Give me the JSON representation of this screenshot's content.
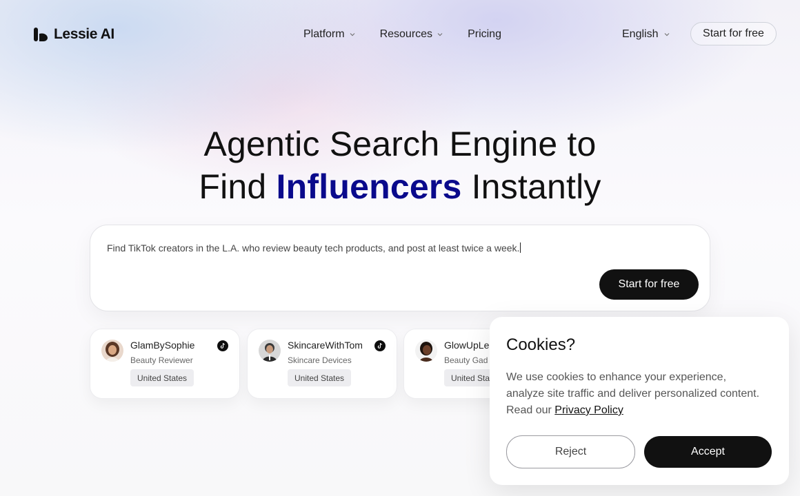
{
  "header": {
    "brand": "Lessie AI",
    "nav": [
      {
        "label": "Platform",
        "has_dropdown": true
      },
      {
        "label": "Resources",
        "has_dropdown": true
      },
      {
        "label": "Pricing",
        "has_dropdown": false
      }
    ],
    "language": "English",
    "cta": "Start for free"
  },
  "hero": {
    "line1": "Agentic Search Engine to",
    "line2_prefix": "Find ",
    "line2_accent": "Influencers",
    "line2_suffix": " Instantly",
    "accent_color": "#0a0a8c"
  },
  "search": {
    "query": "Find TikTok creators in the L.A. who review beauty tech products, and post at least twice a week.",
    "cta": "Start for free"
  },
  "creators": [
    {
      "name": "GlamBySophie",
      "role": "Beauty Reviewer",
      "location": "United States",
      "platform_icon": "tiktok-icon"
    },
    {
      "name": "SkincareWithTom",
      "role": "Skincare Devices",
      "location": "United States",
      "platform_icon": "tiktok-icon"
    },
    {
      "name": "GlowUpLe",
      "role": "Beauty Gad",
      "location": "United Sta",
      "platform_icon": "tiktok-icon"
    }
  ],
  "cookie": {
    "title": "Cookies?",
    "body": "We use cookies to enhance your experience, analyze site traffic and deliver personalized content. Read our ",
    "link": "Privacy Policy",
    "reject": "Reject",
    "accept": "Accept"
  }
}
